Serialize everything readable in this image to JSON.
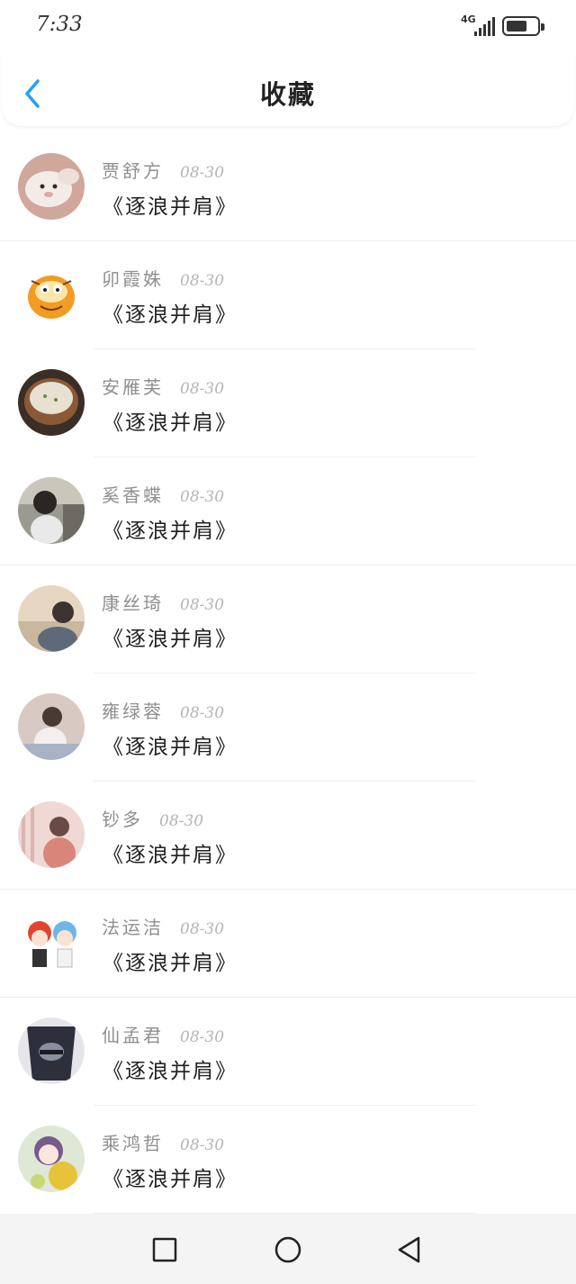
{
  "status": {
    "time": "7:33",
    "network": "4G"
  },
  "header": {
    "title": "收藏"
  },
  "favorites": [
    {
      "name": "贾舒方",
      "date": "08-30",
      "title": "《逐浪并肩》"
    },
    {
      "name": "卯霞姝",
      "date": "08-30",
      "title": "《逐浪并肩》"
    },
    {
      "name": "安雁芙",
      "date": "08-30",
      "title": "《逐浪并肩》"
    },
    {
      "name": "奚香蝶",
      "date": "08-30",
      "title": "《逐浪并肩》"
    },
    {
      "name": "康丝琦",
      "date": "08-30",
      "title": "《逐浪并肩》"
    },
    {
      "name": "雍绿蓉",
      "date": "08-30",
      "title": "《逐浪并肩》"
    },
    {
      "name": "钞多",
      "date": "08-30",
      "title": "《逐浪并肩》"
    },
    {
      "name": "法运洁",
      "date": "08-30",
      "title": "《逐浪并肩》"
    },
    {
      "name": "仙孟君",
      "date": "08-30",
      "title": "《逐浪并肩》"
    },
    {
      "name": "乘鸿哲",
      "date": "08-30",
      "title": "《逐浪并肩》"
    }
  ],
  "icons": {
    "back": "chevron-left-icon",
    "recent": "square-icon",
    "home": "circle-icon",
    "nav_back": "triangle-back-icon"
  },
  "colors": {
    "accent": "#2a9df4",
    "name_text": "#8f8f8f",
    "date_text": "#b5b5b5",
    "title_text": "#1f1f1f"
  }
}
